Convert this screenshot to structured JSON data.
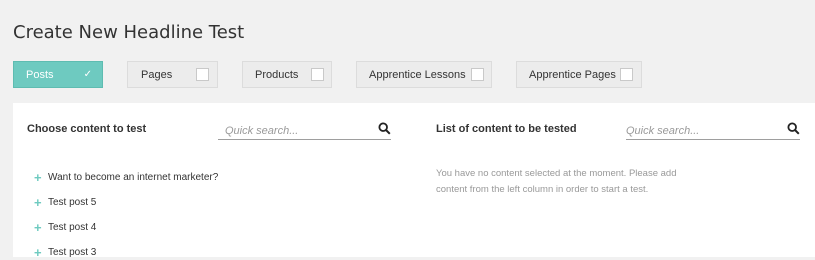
{
  "page": {
    "title": "Create New Headline Test"
  },
  "filters": [
    {
      "label": "Posts",
      "checked": true
    },
    {
      "label": "Pages",
      "checked": false
    },
    {
      "label": "Products",
      "checked": false
    },
    {
      "label": "Apprentice Lessons",
      "checked": false
    },
    {
      "label": "Apprentice Pages",
      "checked": false
    }
  ],
  "left": {
    "title": "Choose content to test",
    "search_placeholder": "Quick search...",
    "items": [
      "Want to become an internet marketer?",
      "Test post 5",
      "Test post 4",
      "Test post 3"
    ]
  },
  "right": {
    "title": "List of content to be tested",
    "search_placeholder": "Quick search...",
    "empty_message": "You have no content selected at the moment. Please add content from the left column in order to start a test."
  },
  "colors": {
    "accent": "#6ecac0",
    "background": "#f1f1f1",
    "panel": "#ffffff"
  },
  "icons": {
    "check": "check-icon",
    "search": "search-icon",
    "add": "plus-icon"
  }
}
